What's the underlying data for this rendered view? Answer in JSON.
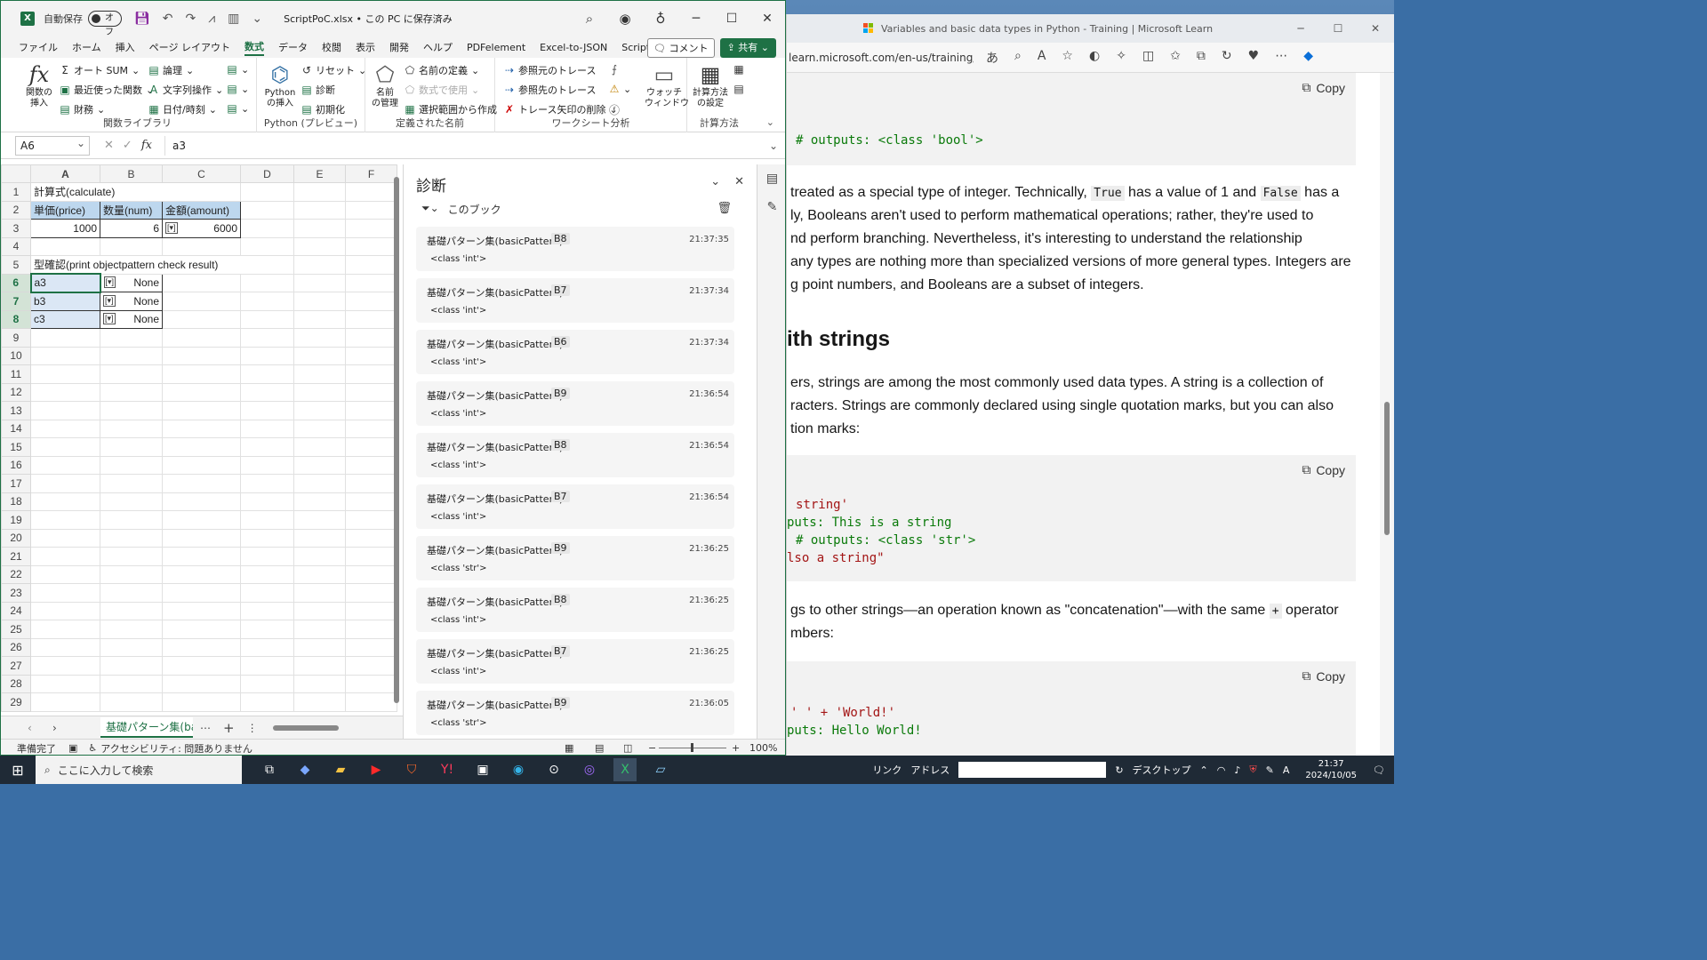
{
  "excel": {
    "autosave_label": "自動保存",
    "autosave_state": "オフ",
    "filename": "ScriptPoC.xlsx • この PC に保存済み",
    "menu": [
      "ファイル",
      "ホーム",
      "挿入",
      "ページ レイアウト",
      "数式",
      "データ",
      "校閲",
      "表示",
      "開発",
      "ヘルプ",
      "PDFelement",
      "Excel-to-JSON",
      "Script Lab"
    ],
    "menu_active": "数式",
    "comment_btn": "コメント",
    "share_btn": "共有",
    "ribbon": {
      "g1": {
        "label": "関数ライブラリ",
        "insert_fn": "関数の\n挿入",
        "autosum": "オート SUM",
        "recent": "最近使った関数",
        "finance": "財務",
        "logic": "論理",
        "text": "文字列操作",
        "datetime": "日付/時刻"
      },
      "g2": {
        "label": "Python (プレビュー)",
        "insert_py": "Python\nの挿入",
        "reset": "リセット",
        "diag": "診断",
        "init": "初期化"
      },
      "g3": {
        "label": "定義された名前",
        "name_mgr": "名前\nの管理",
        "define_name": "名前の定義",
        "use_formula": "数式で使用",
        "create_sel": "選択範囲から作成"
      },
      "g4": {
        "label": "ワークシート分析",
        "trace_prec": "参照元のトレース",
        "trace_dep": "参照先のトレース",
        "remove_arrows": "トレース矢印の削除",
        "watch": "ウォッチ\nウィンドウ"
      },
      "g5": {
        "label": "計算方法",
        "calc_opts": "計算方法\nの設定"
      }
    },
    "namebox": "A6",
    "formula": "a3",
    "columns": [
      "A",
      "B",
      "C",
      "D",
      "E",
      "F"
    ],
    "cells": {
      "r1": "計算式(calculate)",
      "r2": [
        "単価(price)",
        "数量(num)",
        "金額(amount)"
      ],
      "r3": [
        "1000",
        "6",
        "6000"
      ],
      "r5": "型確認(print objectpattern check result)",
      "r6": [
        "a3",
        "None"
      ],
      "r7": [
        "b3",
        "None"
      ],
      "r8": [
        "c3",
        "None"
      ]
    },
    "sheet_tab": "基礎パターン集(basi",
    "status": {
      "ready": "準備完了",
      "accessibility": "アクセシビリティ: 問題ありません",
      "zoom": "100%"
    }
  },
  "diagnostics": {
    "title": "診断",
    "filter": "このブック",
    "entries": [
      {
        "src": "基礎パターン集(basicPattern)",
        "cell": "B8",
        "time": "21:37:35",
        "val": "<class 'int'>"
      },
      {
        "src": "基礎パターン集(basicPattern)",
        "cell": "B7",
        "time": "21:37:34",
        "val": "<class 'int'>"
      },
      {
        "src": "基礎パターン集(basicPattern)",
        "cell": "B6",
        "time": "21:37:34",
        "val": "<class 'int'>"
      },
      {
        "src": "基礎パターン集(basicPattern)",
        "cell": "B9",
        "time": "21:36:54",
        "val": "<class 'int'>"
      },
      {
        "src": "基礎パターン集(basicPattern)",
        "cell": "B8",
        "time": "21:36:54",
        "val": "<class 'int'>"
      },
      {
        "src": "基礎パターン集(basicPattern)",
        "cell": "B7",
        "time": "21:36:54",
        "val": "<class 'int'>"
      },
      {
        "src": "基礎パターン集(basicPattern)",
        "cell": "B9",
        "time": "21:36:25",
        "val": "<class 'str'>"
      },
      {
        "src": "基礎パターン集(basicPattern)",
        "cell": "B8",
        "time": "21:36:25",
        "val": "<class 'int'>"
      },
      {
        "src": "基礎パターン集(basicPattern)",
        "cell": "B7",
        "time": "21:36:25",
        "val": "<class 'int'>"
      },
      {
        "src": "基礎パターン集(basicPattern)",
        "cell": "B9",
        "time": "21:36:05",
        "val": "<class 'str'>"
      }
    ]
  },
  "edge": {
    "tab_title": "Variables and basic data types in Python - Training | Microsoft Learn",
    "url": "learn.microsoft.com/en-us/training/mo...",
    "copy": "Copy",
    "code1": "# outputs: <class 'bool'>",
    "p1": {
      "l1a": "treated as a special type of integer. Technically, ",
      "l1b": "True",
      "l1c": " has a value of 1 and ",
      "l1d": "False",
      "l1e": " has a",
      "l2": "ly, Booleans aren't used to perform mathematical operations; rather, they're used to",
      "l3": "nd perform branching. Nevertheless, it's interesting to understand the relationship",
      "l4": "any types are nothing more than specialized versions of more general types. Integers are",
      "l5": "g point numbers, and Booleans are a subset of integers."
    },
    "heading": "ith strings",
    "p2": {
      "l1": "ers, strings are among the most commonly used data types. A string is a collection of",
      "l2": "racters. Strings are commonly declared using single quotation marks, but you can also",
      "l3": "tion marks:"
    },
    "code2": [
      "string'",
      "puts: This is a string",
      "# outputs: <class 'str'>",
      "lso a string\""
    ],
    "p3": {
      "l1a": "gs to other strings—an operation known as \"concatenation\"—with the same ",
      "l1b": "+",
      "l1c": " operator",
      "l2": "mbers:"
    },
    "code3": [
      "' ' + 'World!'",
      "puts: Hello World!"
    ]
  },
  "taskbar": {
    "search": "ここに入力して検索",
    "link": "リンク",
    "address": "アドレス",
    "desktop": "デスクトップ",
    "time": "21:37",
    "date": "2024/10/05"
  }
}
